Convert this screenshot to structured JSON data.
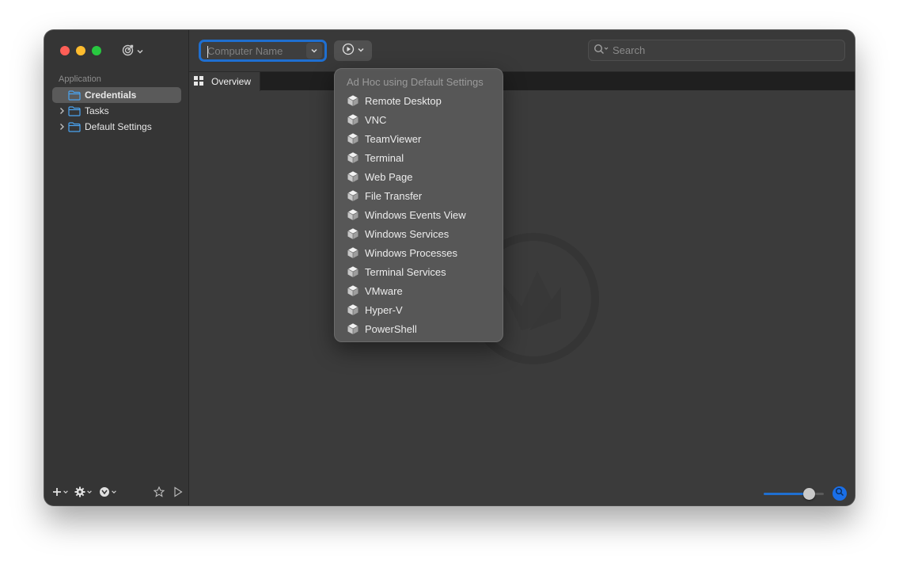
{
  "toolbar": {
    "computer_name_placeholder": "Computer Name",
    "search_placeholder": "Search"
  },
  "sidebar": {
    "section_label": "Application",
    "items": [
      {
        "label": "Credentials",
        "selected": true,
        "expandable": false
      },
      {
        "label": "Tasks",
        "selected": false,
        "expandable": true
      },
      {
        "label": "Default Settings",
        "selected": false,
        "expandable": true
      }
    ]
  },
  "tabs": [
    {
      "label": "Overview",
      "icon": "grid-icon"
    }
  ],
  "dropdown": {
    "header": "Ad Hoc using Default Settings",
    "items": [
      "Remote Desktop",
      "VNC",
      "TeamViewer",
      "Terminal",
      "Web Page",
      "File Transfer",
      "Windows Events View",
      "Windows Services",
      "Windows Processes",
      "Terminal Services",
      "VMware",
      "Hyper-V",
      "PowerShell"
    ]
  },
  "zoom": {
    "level": 0.75
  },
  "colors": {
    "accent": "#1f6fd0",
    "folder": "#4aa3f0"
  }
}
